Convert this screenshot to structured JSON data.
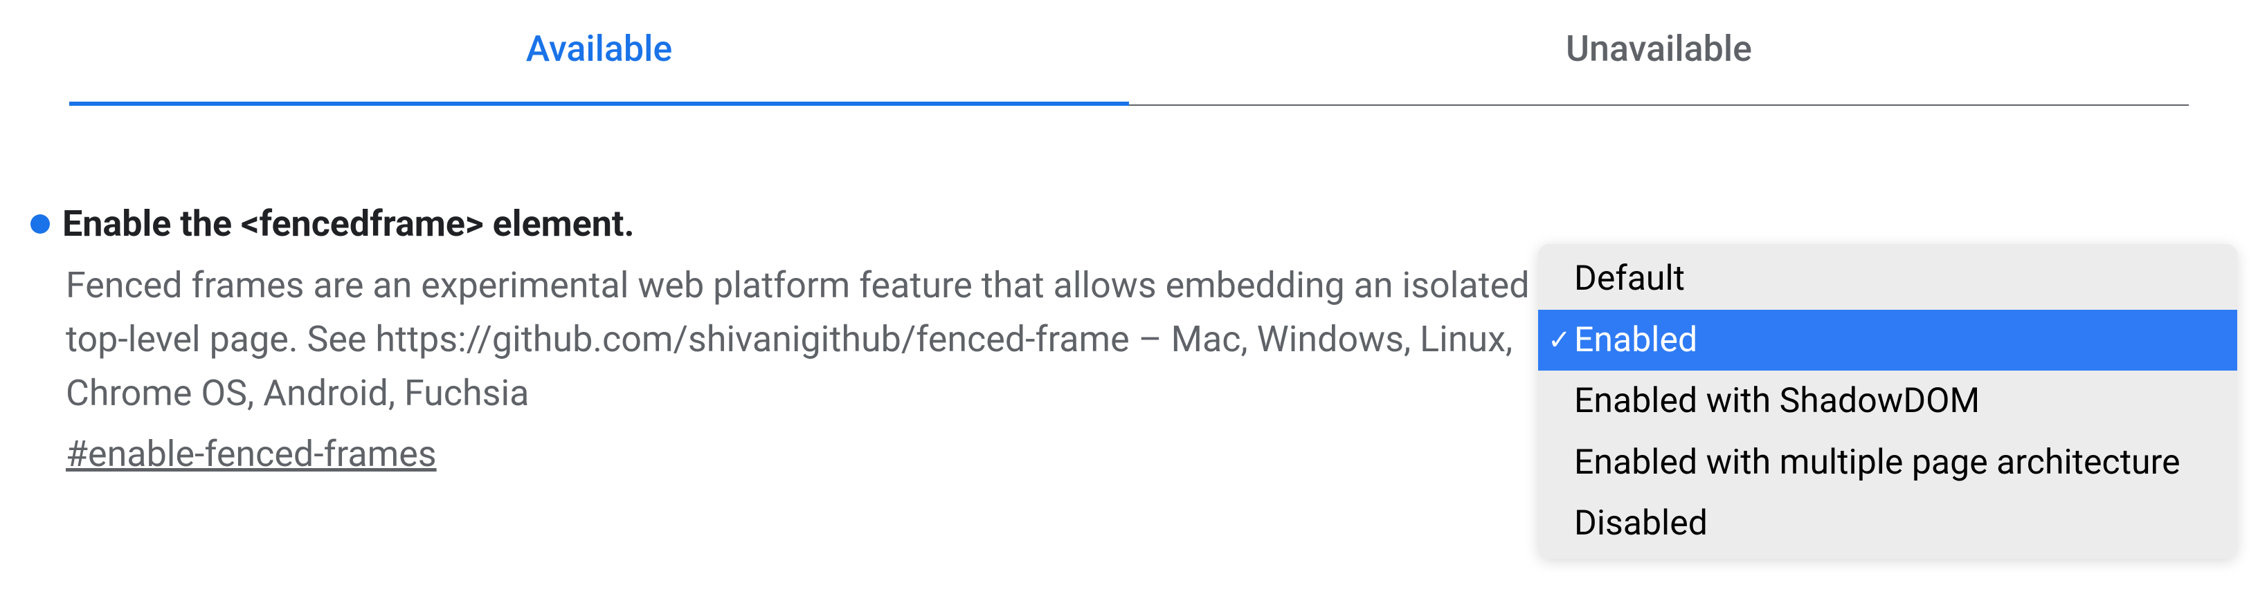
{
  "tabs": {
    "available": "Available",
    "unavailable": "Unavailable"
  },
  "flag": {
    "title": "Enable the <fencedframe> element.",
    "description": "Fenced frames are an experimental web platform feature that allows embedding an isolated top-level page. See https://github.com/shivanigithub/fenced-frame – Mac, Windows, Linux, Chrome OS, Android, Fuchsia",
    "anchor": "#enable-fenced-frames"
  },
  "dropdown": {
    "options": [
      "Default",
      "Enabled",
      "Enabled with ShadowDOM",
      "Enabled with multiple page architecture",
      "Disabled"
    ],
    "selected_index": 1
  }
}
